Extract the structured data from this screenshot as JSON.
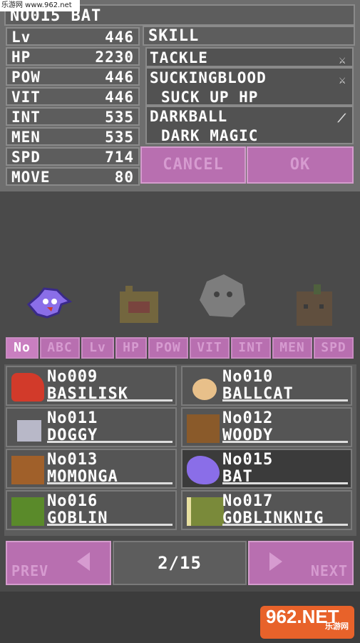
{
  "watermark": "乐游网 www.962.net",
  "monster": {
    "title": "NO015 BAT"
  },
  "stats": [
    {
      "label": "Lv",
      "value": "446"
    },
    {
      "label": "HP",
      "value": "2230"
    },
    {
      "label": "POW",
      "value": "446"
    },
    {
      "label": "VIT",
      "value": "446"
    },
    {
      "label": "INT",
      "value": "535"
    },
    {
      "label": "MEN",
      "value": "535"
    },
    {
      "label": "SPD",
      "value": "714"
    },
    {
      "label": "MOVE",
      "value": "80"
    }
  ],
  "skills": {
    "header": "SKILL",
    "list": [
      {
        "name": "TACKLE",
        "desc": "",
        "icon": "sword-icon"
      },
      {
        "name": "SUCKINGBLOOD",
        "desc": "SUCK UP HP",
        "icon": "sword-icon"
      },
      {
        "name": "DARKBALL",
        "desc": "DARK MAGIC",
        "icon": "wand-icon"
      }
    ]
  },
  "buttons": {
    "cancel": "CANCEL",
    "ok": "OK"
  },
  "sort_tabs": [
    "No",
    "ABC",
    "Lv",
    "HP",
    "POW",
    "VIT",
    "INT",
    "MEN",
    "SPD"
  ],
  "entries": [
    {
      "no": "No009",
      "name": "BASILISK",
      "color": "#d23a2a"
    },
    {
      "no": "No010",
      "name": "BALLCAT",
      "color": "#e8c08a"
    },
    {
      "no": "No011",
      "name": "DOGGY",
      "color": "#b8b8c8"
    },
    {
      "no": "No012",
      "name": "WOODY",
      "color": "#8a5a2a"
    },
    {
      "no": "No013",
      "name": "MOMONGA",
      "color": "#a0602a"
    },
    {
      "no": "No015",
      "name": "BAT",
      "color": "#8a6ee8"
    },
    {
      "no": "No016",
      "name": "GOBLIN",
      "color": "#5a8a2a"
    },
    {
      "no": "No017",
      "name": "GOBLINKNIG",
      "color": "#7a8a3a"
    }
  ],
  "pager": {
    "prev": "PREV",
    "next": "NEXT",
    "page": "2/15"
  },
  "logo": {
    "text": "962.NET",
    "sub": "乐游网"
  }
}
